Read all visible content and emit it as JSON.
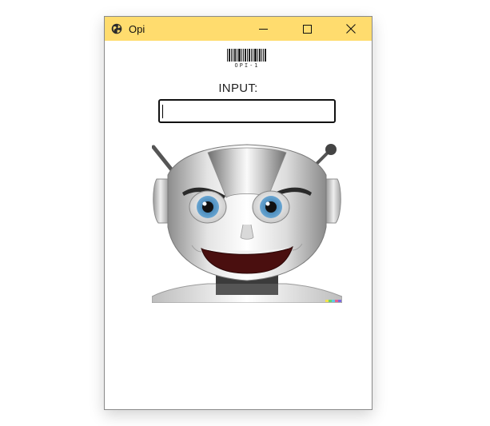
{
  "window": {
    "title": "Opi",
    "titlebar_color": "#ffdc6e",
    "controls": {
      "minimize_icon": "minimize-icon",
      "maximize_icon": "maximize-icon",
      "close_icon": "close-icon"
    }
  },
  "barcode": {
    "text": "OPI-1"
  },
  "form": {
    "label": "INPUT:",
    "input_value": "",
    "input_placeholder": ""
  },
  "image": {
    "subject": "robot-face",
    "icon": "robot-face-image"
  }
}
